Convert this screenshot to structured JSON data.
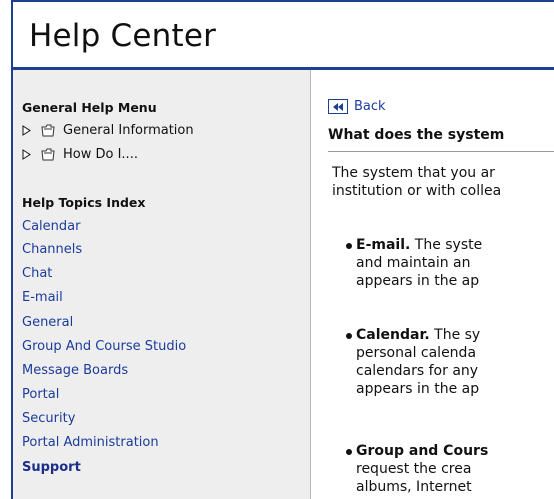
{
  "header": {
    "title": "Help Center"
  },
  "sidebar": {
    "general_heading": "General Help Menu",
    "tree": [
      {
        "label": "General Information",
        "arrow": "triangle-right-icon",
        "icon": "folder-icon"
      },
      {
        "label": "How Do I....",
        "arrow": "triangle-right-icon",
        "icon": "folder-icon"
      }
    ],
    "topics_heading": "Help Topics Index",
    "topics": [
      {
        "label": "Calendar"
      },
      {
        "label": "Channels"
      },
      {
        "label": "Chat"
      },
      {
        "label": "E-mail"
      },
      {
        "label": "General"
      },
      {
        "label": "Group And Course Studio"
      },
      {
        "label": "Message Boards"
      },
      {
        "label": "Portal"
      },
      {
        "label": "Security"
      },
      {
        "label": "Portal Administration"
      },
      {
        "label": "Support"
      }
    ]
  },
  "content": {
    "back_label": "Back",
    "back_icon": "rewind-icon",
    "heading": "What does the system",
    "intro": [
      "The system that you ar",
      "institution or with collea"
    ],
    "bullets": [
      {
        "term": "E-mail.",
        "lines": [
          " The syste",
          "and maintain an",
          "appears in the ap"
        ]
      },
      {
        "term": "Calendar.",
        "lines": [
          " The sy",
          "personal calenda",
          "calendars for any",
          "appears in the ap"
        ]
      },
      {
        "term": "Group and Cours",
        "lines": [
          "",
          "request the crea",
          "albums, Internet"
        ]
      }
    ]
  },
  "colors": {
    "accent": "#1f3f8f",
    "link": "#1b3c9b",
    "sidebar_bg": "#eeeeee"
  }
}
